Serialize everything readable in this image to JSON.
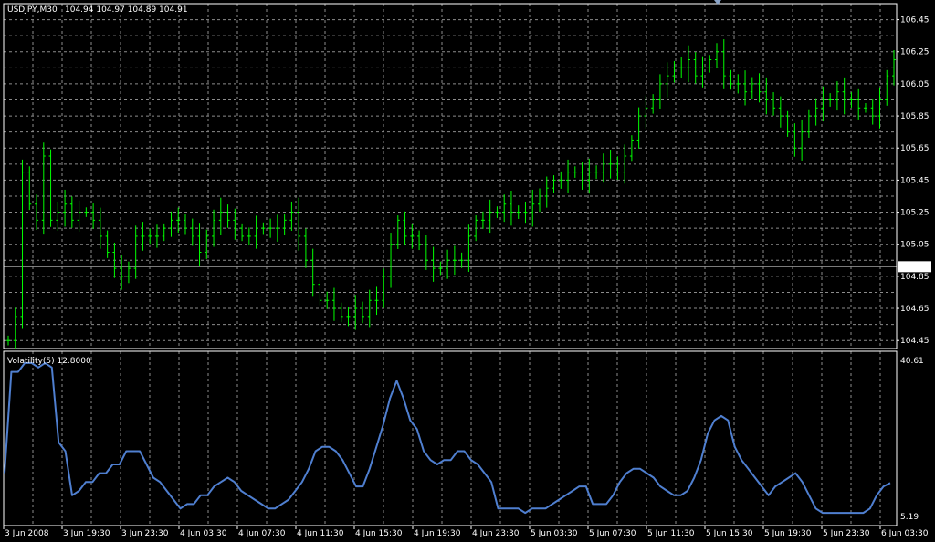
{
  "header": {
    "symbol": "USDJPY,M30",
    "ohlc": "104.94 104.97 104.89 104.91"
  },
  "indicator": {
    "label": "Volatility(5) 12.8000"
  },
  "colors": {
    "background": "#000000",
    "grid": "#8c8c8c",
    "price_bars": "#00ff00",
    "indicator_line": "#4f7fd0",
    "frame": "#ffffff",
    "price_tag_bg": "#ffffff",
    "price_tag_text": "#000000"
  },
  "chart_data": [
    {
      "type": "ohlc-bar",
      "title": "USDJPY,M30",
      "ylim": [
        104.4,
        106.55
      ],
      "y_ticks": [
        "106.45",
        "106.25",
        "106.05",
        "105.85",
        "105.65",
        "105.45",
        "105.25",
        "105.05",
        "104.85",
        "104.65",
        "104.45"
      ],
      "last_price": "104.91",
      "grid": true,
      "series": [
        {
          "values": [
            104.45,
            104.6,
            105.5,
            105.3,
            105.2,
            105.6,
            105.2,
            105.25,
            105.3,
            105.2,
            105.25,
            105.25,
            105.2,
            105.1,
            105,
            104.9,
            104.85,
            104.9,
            105.1,
            105.1,
            105.1,
            105.1,
            105.15,
            105.2,
            105.2,
            105.15,
            105.1,
            105,
            105.1,
            105.2,
            105.25,
            105.2,
            105.15,
            105.1,
            105.1,
            105.15,
            105.15,
            105.15,
            105.15,
            105.2,
            105.25,
            105.1,
            104.95,
            104.8,
            104.7,
            104.7,
            104.65,
            104.6,
            104.6,
            104.65,
            104.6,
            104.7,
            104.7,
            104.85,
            105.05,
            105.2,
            105.1,
            105.1,
            105.05,
            104.95,
            104.9,
            104.9,
            104.95,
            104.95,
            104.95,
            105.1,
            105.2,
            105.2,
            105.25,
            105.25,
            105.3,
            105.25,
            105.25,
            105.25,
            105.3,
            105.35,
            105.4,
            105.45,
            105.45,
            105.5,
            105.5,
            105.45,
            105.5,
            105.5,
            105.55,
            105.55,
            105.5,
            105.6,
            105.7,
            105.85,
            105.9,
            105.95,
            106.05,
            106.1,
            106.15,
            106.15,
            106.2,
            106.1,
            106.15,
            106.2,
            106.25,
            106.1,
            106.05,
            106.05,
            106.0,
            106.05,
            106.0,
            105.95,
            105.9,
            105.85,
            105.75,
            105.65,
            105.75,
            105.85,
            105.9,
            105.95,
            105.95,
            106.0,
            105.95,
            105.95,
            105.9,
            105.9,
            105.85,
            105.95,
            106.1,
            106.2
          ]
        }
      ]
    },
    {
      "type": "line",
      "title": "Volatility(5) 12.8000",
      "ylim": [
        5.19,
        40.61
      ],
      "y_ticks": [
        "40.61",
        "5.19"
      ],
      "x_ticks": [
        "3 Jun 2008",
        "3 Jun 19:30",
        "3 Jun 23:30",
        "4 Jun 03:30",
        "4 Jun 07:30",
        "4 Jun 11:30",
        "4 Jun 15:30",
        "4 Jun 19:30",
        "4 Jun 23:30",
        "5 Jun 03:30",
        "5 Jun 07:30",
        "5 Jun 11:30",
        "5 Jun 15:30",
        "5 Jun 19:30",
        "5 Jun 23:30",
        "6 Jun 03:30"
      ],
      "series": [
        {
          "name": "Volatility(5)",
          "values": [
            15,
            38,
            38,
            40,
            40,
            39,
            40,
            39,
            22,
            20,
            10,
            11,
            13,
            13,
            15,
            15,
            17,
            17,
            20,
            20,
            20,
            17,
            14,
            13,
            11,
            9,
            7,
            8,
            8,
            10,
            10,
            12,
            13,
            14,
            13,
            11,
            10,
            9,
            8,
            7,
            7,
            8,
            9,
            11,
            13,
            16,
            20,
            21,
            21,
            20,
            18,
            15,
            12,
            12,
            16,
            21,
            26,
            32,
            36,
            32,
            27,
            25,
            20,
            18,
            17,
            18,
            18,
            20,
            20,
            18,
            17,
            15,
            13,
            7,
            7,
            7,
            7,
            6,
            7,
            7,
            7,
            8,
            9,
            10,
            11,
            12,
            12,
            8,
            8,
            8,
            10,
            13,
            15,
            16,
            16,
            15,
            14,
            12,
            11,
            10,
            10,
            11,
            14,
            18,
            24,
            27,
            28,
            27,
            21,
            18,
            16,
            14,
            12,
            10,
            12,
            13,
            14,
            15,
            13,
            10,
            7,
            6,
            6,
            6,
            6,
            6,
            6,
            6,
            7,
            10,
            12,
            12.8
          ]
        }
      ]
    }
  ]
}
